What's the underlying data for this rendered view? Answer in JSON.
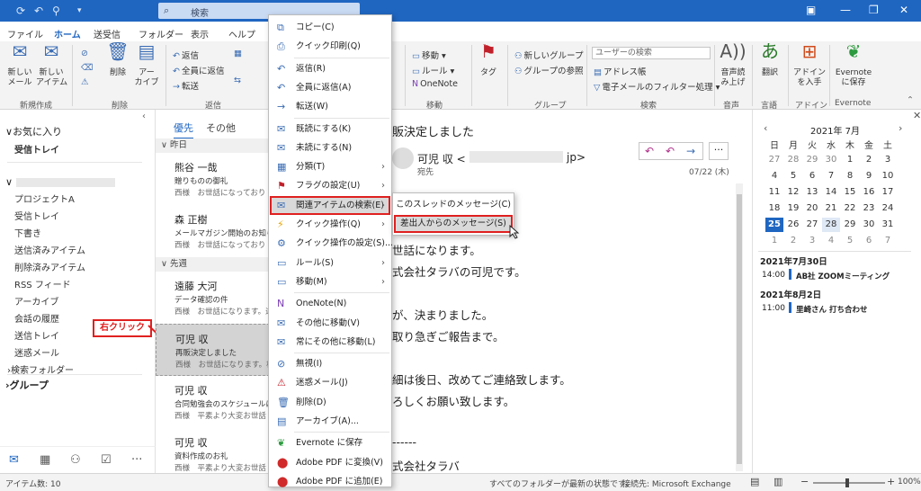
{
  "titlebar": {
    "search_placeholder": "検索"
  },
  "tabs": [
    "ファイル",
    "ホーム",
    "送受信",
    "フォルダー",
    "表示",
    "ヘルプ"
  ],
  "ribbon": {
    "new_mail": "新しい\nメール",
    "new_item": "新しい\nアイテム",
    "group_new": "新規作成",
    "delete": "削除",
    "archive": "アー\nカイブ",
    "group_delete": "削除",
    "reply": "返信",
    "reply_all": "全員に返信",
    "forward": "転送",
    "group_reply": "返信",
    "move": "移動",
    "rules": "ルール",
    "onenote": "OneNote",
    "group_move": "移動",
    "tags": "タグ",
    "new_group": "新しいグループ",
    "browse_groups": "グループの参照",
    "group_groups": "グループ",
    "user_search_placeholder": "ユーザーの検索",
    "address_book": "アドレス帳",
    "filter_email": "電子メールのフィルター処理",
    "group_find": "検索",
    "read_aloud": "音声読\nみ上げ",
    "group_speech": "音声",
    "translate": "翻訳",
    "group_language": "言語",
    "get_addins": "アドイン\nを入手",
    "group_addins": "アドイン",
    "evernote_save": "Evernote\nに保存",
    "group_evernote": "Evernote"
  },
  "nav": {
    "favorites": "お気に入り",
    "inbox_fav": "受信トレイ",
    "folders": [
      "プロジェクトA",
      "受信トレイ",
      "下書き",
      "送信済みアイテム",
      "削除済みアイテム",
      "RSS フィード",
      "アーカイブ",
      "会話の履歴",
      "送信トレイ",
      "迷惑メール"
    ],
    "search_folders": "検索フォルダー",
    "groups": "グループ"
  },
  "list": {
    "tab_focused": "優先",
    "tab_other": "その他",
    "group_yesterday": "昨日",
    "group_lastweek": "先週",
    "mails": [
      {
        "from": "熊谷 一哉",
        "subject": "贈りものの御礼",
        "preview": "西様　お世話になっており"
      },
      {
        "from": "森 正樹",
        "subject": "メールマガジン開始のお知らせ",
        "preview": "西様　お世話になっており"
      },
      {
        "from": "遠藤 大河",
        "subject": "データ確認の件",
        "preview": "西様　お世話になります。遠"
      },
      {
        "from": "可児 収",
        "subject": "再販決定しました",
        "preview": "西様　お世話になります。株"
      },
      {
        "from": "可児 収",
        "subject": "合同勉強会のスケジュールに",
        "preview": "西様　平素より大変お世話"
      },
      {
        "from": "可児 収",
        "subject": "資料作成のお礼",
        "preview": "西様　平素より大変お世話"
      }
    ]
  },
  "reading": {
    "subject": "販決定しました",
    "from": "可児 収 <",
    "from_domain": "jp>",
    "to_label": "宛先",
    "date": "07/22 (木)",
    "body": [
      "世話になります。",
      "式会社タラバの可児です。",
      "が、決まりました。",
      "取り急ぎご報告まで。",
      "細は後日、改めてご連絡致します。",
      "ろしくお願い致します。",
      "------",
      "式会社タラバ"
    ]
  },
  "calendar": {
    "month": "2021年 7月",
    "weekdays": [
      "日",
      "月",
      "火",
      "水",
      "木",
      "金",
      "土"
    ],
    "weeks": [
      [
        "27",
        "28",
        "29",
        "30",
        "1",
        "2",
        "3"
      ],
      [
        "4",
        "5",
        "6",
        "7",
        "8",
        "9",
        "10"
      ],
      [
        "11",
        "12",
        "13",
        "14",
        "15",
        "16",
        "17"
      ],
      [
        "18",
        "19",
        "20",
        "21",
        "22",
        "23",
        "24"
      ],
      [
        "25",
        "26",
        "27",
        "28",
        "29",
        "30",
        "31"
      ],
      [
        "1",
        "2",
        "3",
        "4",
        "5",
        "6",
        "7"
      ]
    ],
    "today": "25",
    "events": [
      {
        "date": "2021年7月30日",
        "time": "14:00",
        "title": "AB社 ZOOMミーティング"
      },
      {
        "date": "2021年8月2日",
        "time": "11:00",
        "title": "里崎さん 打ち合わせ"
      }
    ]
  },
  "context_menu": [
    {
      "label": "コピー(C)",
      "icon": "copy-icon"
    },
    {
      "label": "クイック印刷(Q)",
      "icon": "print-icon"
    },
    {
      "label": "返信(R)",
      "icon": "reply-icon"
    },
    {
      "label": "全員に返信(A)",
      "icon": "reply-all-icon"
    },
    {
      "label": "転送(W)",
      "icon": "forward-icon"
    },
    {
      "label": "既読にする(K)",
      "icon": "open-envelope-icon"
    },
    {
      "label": "未読にする(N)",
      "icon": "envelope-icon"
    },
    {
      "label": "分類(T)",
      "icon": "category-icon"
    },
    {
      "label": "フラグの設定(U)",
      "icon": "flag-icon"
    },
    {
      "label": "関連アイテムの検索(E)",
      "icon": "related-search-icon"
    },
    {
      "label": "クイック操作(Q)",
      "icon": "lightning-icon"
    },
    {
      "label": "クイック操作の設定(S)...",
      "icon": "gear-icon"
    },
    {
      "label": "ルール(S)",
      "icon": "rules-icon"
    },
    {
      "label": "移動(M)",
      "icon": "move-icon"
    },
    {
      "label": "OneNote(N)",
      "icon": "onenote-icon"
    },
    {
      "label": "その他に移動(V)",
      "icon": "move-other-icon"
    },
    {
      "label": "常にその他に移動(L)",
      "icon": "always-move-icon"
    },
    {
      "label": "無視(I)",
      "icon": "ignore-icon"
    },
    {
      "label": "迷惑メール(J)",
      "icon": "junk-icon"
    },
    {
      "label": "削除(D)",
      "icon": "trash-icon"
    },
    {
      "label": "アーカイブ(A)...",
      "icon": "archive-icon"
    },
    {
      "label": "Evernote に保存",
      "icon": "evernote-icon"
    },
    {
      "label": "Adobe PDF に変換(V)",
      "icon": "pdf-icon"
    },
    {
      "label": "Adobe PDF に追加(E)",
      "icon": "pdf-add-icon"
    }
  ],
  "submenu": {
    "thread": "このスレッドのメッセージ(C)",
    "sender": "差出人からのメッセージ(S)"
  },
  "callout": "右クリック",
  "status": {
    "items": "アイテム数: 10",
    "uptodate": "すべてのフォルダーが最新の状態です。",
    "connection": "接続先: Microsoft Exchange",
    "zoom": "100%"
  },
  "colors": {
    "accent": "#1f66c1",
    "highlight_red": "#e02020"
  }
}
